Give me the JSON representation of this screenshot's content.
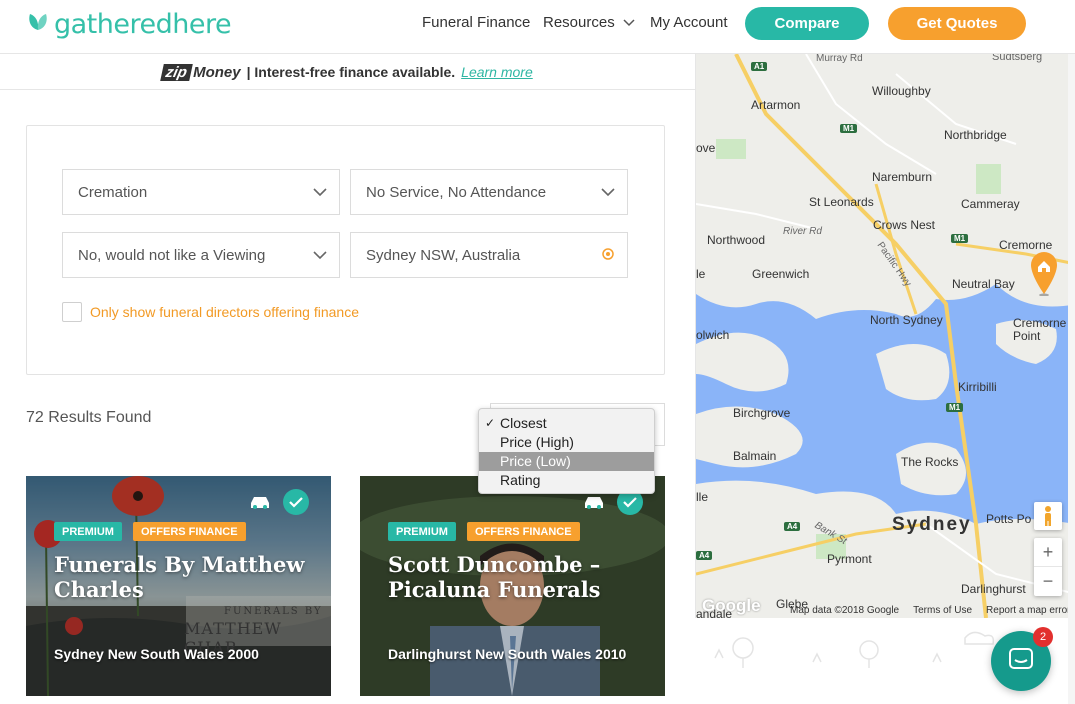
{
  "header": {
    "logo_text": "gatheredhere",
    "nav": {
      "funeral_finance": "Funeral Finance",
      "resources": "Resources",
      "my_account": "My Account"
    },
    "compare_label": "Compare",
    "quotes_label": "Get Quotes"
  },
  "banner": {
    "zip_a": "zip",
    "zip_b": "Money",
    "text": "| Interest-free finance available.",
    "link": "Learn more"
  },
  "filters": {
    "service_type": "Cremation",
    "attendance": "No Service, No Attendance",
    "viewing": "No, would not like a Viewing",
    "location": "Sydney NSW, Australia",
    "finance_only_label": "Only show funeral directors offering finance"
  },
  "results": {
    "count_text": "72 Results Found"
  },
  "sort_dropdown": {
    "options": [
      "Closest",
      "Price (High)",
      "Price (Low)",
      "Rating"
    ],
    "selected": "Closest",
    "highlighted": "Price (Low)"
  },
  "cards": [
    {
      "badge_premium": "PREMIUM",
      "badge_finance": "OFFERS FINANCE",
      "title": "Funerals By Matthew Charles",
      "location": "Sydney New South Wales 2000",
      "sign_line1": "FUNERALS BY",
      "sign_line2": "MATTHEW CHAR"
    },
    {
      "badge_premium": "PREMIUM",
      "badge_finance": "OFFERS FINANCE",
      "title": "Scott Duncombe – Picaluna Funerals",
      "location": "Darlinghurst New South Wales 2010"
    }
  ],
  "map": {
    "labels": {
      "artarmon": "Artarmon",
      "willoughby": "Willoughby",
      "northbridge": "Northbridge",
      "naremburn": "Naremburn",
      "st_leonards": "St Leonards",
      "cammeray": "Cammeray",
      "crows_nest": "Crows Nest",
      "northwood": "Northwood",
      "river_rd": "River Rd",
      "cremorne": "Cremorne",
      "greenwich": "Greenwich",
      "neutral_bay": "Neutral Bay",
      "north_sydney": "North Sydney",
      "cremorne_point": "Cremorne\nPoint",
      "kirribilli": "Kirribilli",
      "birchgrove": "Birchgrove",
      "balmain": "Balmain",
      "the_rocks": "The Rocks",
      "sydney": "Sydney",
      "potts_point": "Potts Po",
      "pyrmont": "Pyrmont",
      "darlinghurst": "Darlinghurst",
      "glebe": "Glebe",
      "bank_st": "Bank St",
      "pacific_hwy": "Pacific Hwy",
      "murray_rd": "Murray Rd",
      "ove": "ove",
      "lwich": "olwich",
      "le": "le",
      "lle": "lle",
      "andale": "andale",
      "sudtsberg": "Sudtsberg"
    },
    "shields": [
      "A1",
      "M1",
      "M1",
      "M1",
      "A4",
      "A4"
    ],
    "footer": {
      "data": "Map data ©2018 Google",
      "terms": "Terms of Use",
      "report": "Report a map error"
    },
    "google": "Google",
    "zoom_in": "+",
    "zoom_out": "−"
  },
  "chat": {
    "badge_count": "2"
  },
  "colors": {
    "brand_teal": "#28b8a6",
    "brand_orange": "#f7a02e",
    "water": "#8ab4f8"
  }
}
